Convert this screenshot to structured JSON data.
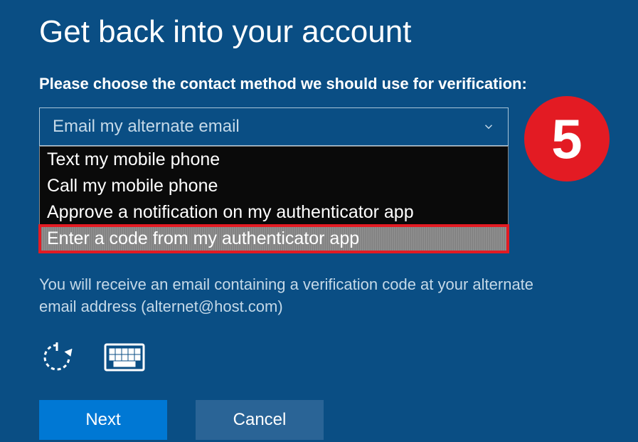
{
  "title": "Get back into your account",
  "instruction": "Please choose the contact method we should use for verification:",
  "dropdown": {
    "selected": "Email my alternate email",
    "options": {
      "opt1": "Text my mobile phone",
      "opt2": "Call my mobile phone",
      "opt3": "Approve a notification on my authenticator app",
      "opt4": "Enter a code from my authenticator app"
    }
  },
  "info_text": "You will receive an email containing a verification code at your alternate email address (alternet@host.com)",
  "buttons": {
    "next": "Next",
    "cancel": "Cancel"
  },
  "step_number": "5"
}
